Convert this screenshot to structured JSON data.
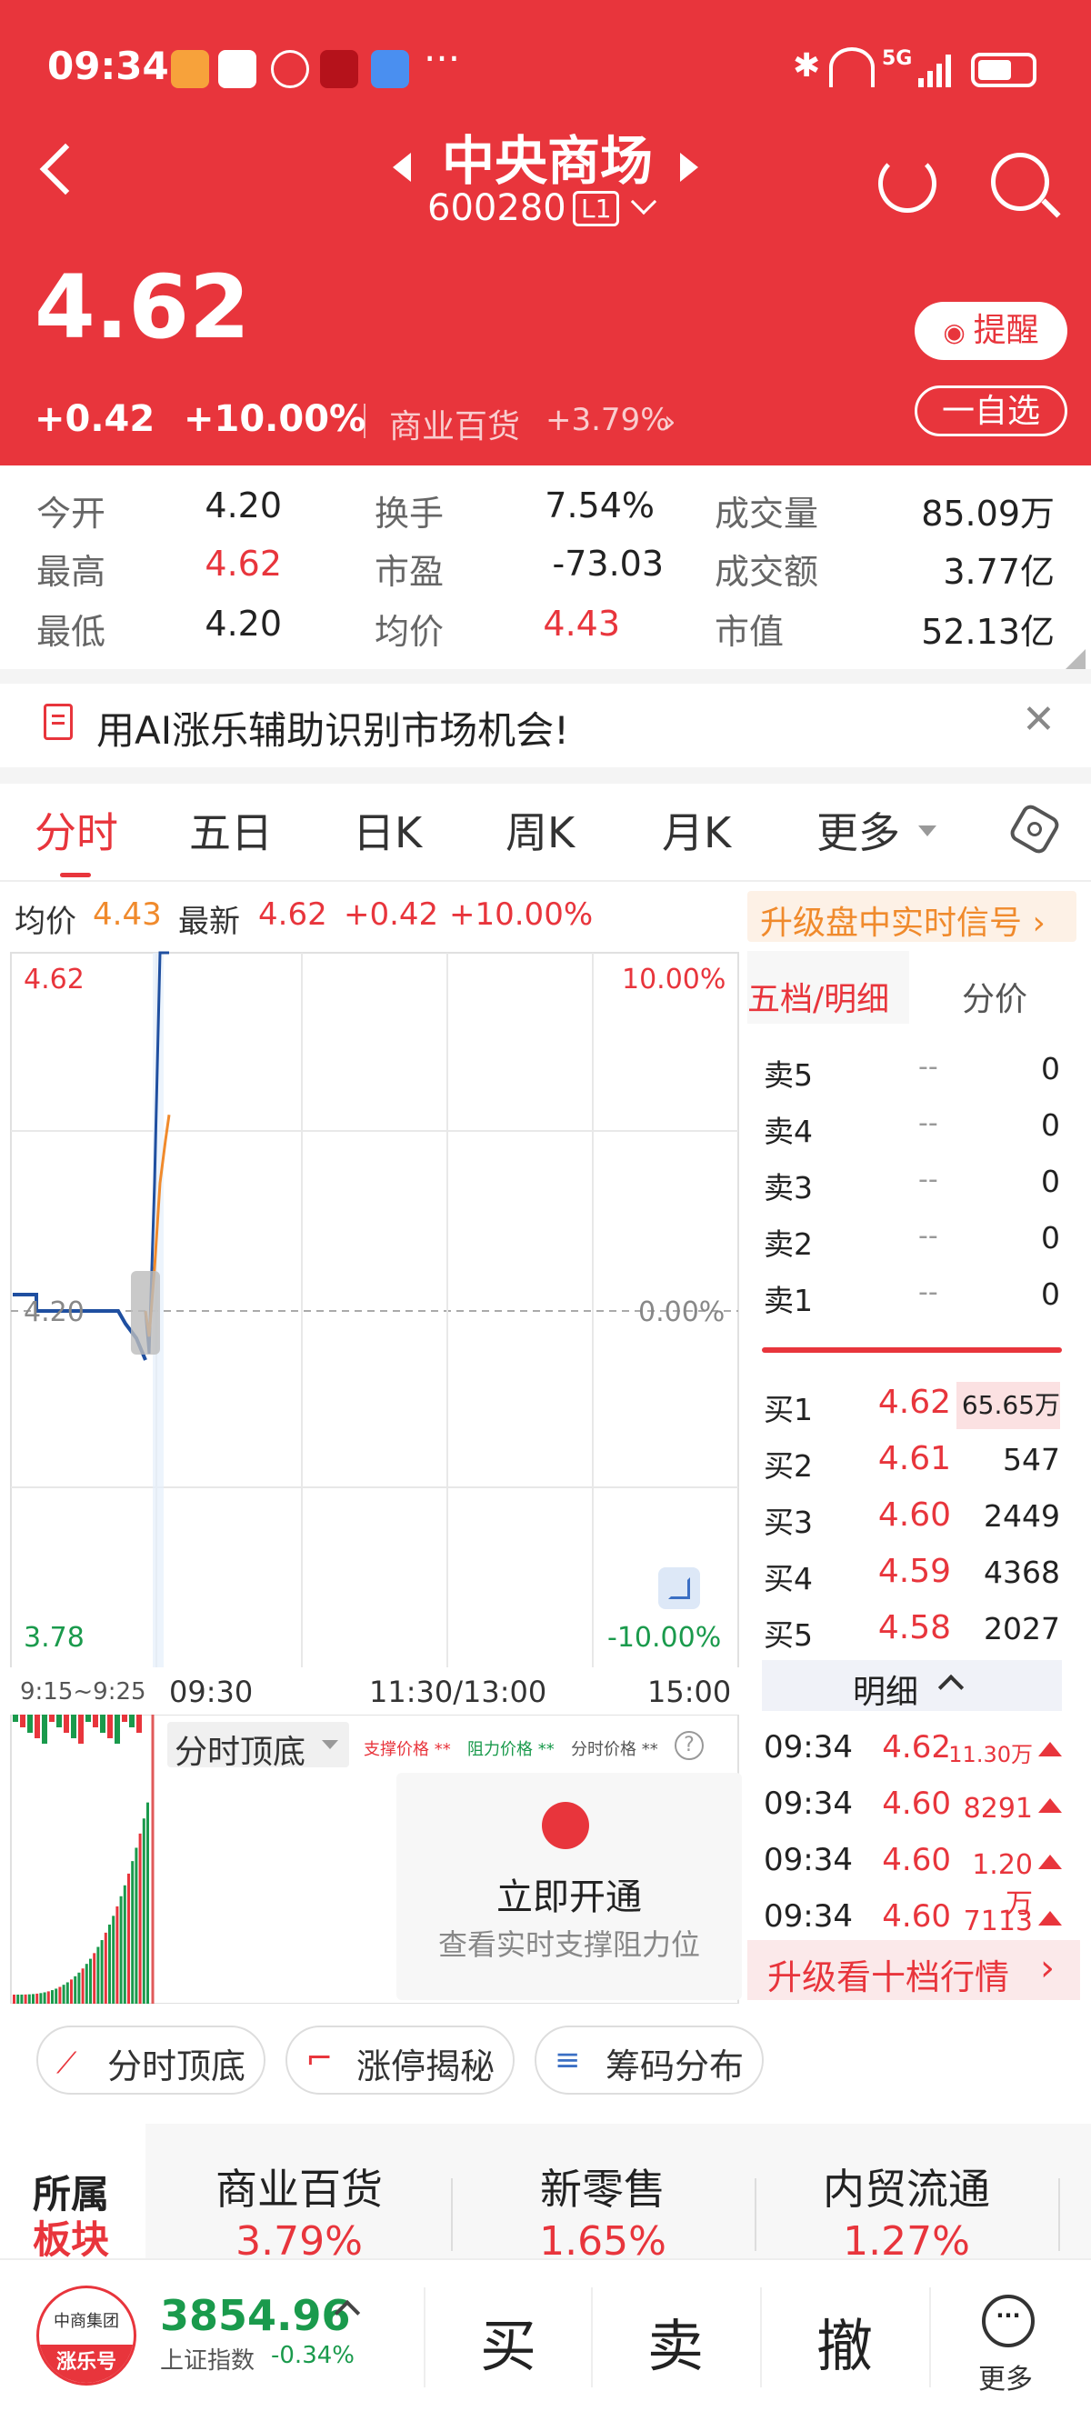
{
  "status_bar": {
    "time": "09:34",
    "more": "···",
    "net": "5G"
  },
  "nav": {
    "stock_name": "中央商场",
    "stock_code": "600280",
    "level": "L1"
  },
  "quote": {
    "price": "4.62",
    "change": "+0.42",
    "change_pct": "+10.00%",
    "sector_name": "商业百货",
    "sector_change": "+3.79%",
    "remind_label": "提醒",
    "watchlist_label": "一自选"
  },
  "stats": {
    "open_label": "今开",
    "open": "4.20",
    "turnover_label": "换手",
    "turnover": "7.54%",
    "volume_label": "成交量",
    "volume": "85.09万",
    "high_label": "最高",
    "high": "4.62",
    "pe_label": "市盈",
    "pe": "-73.03",
    "amount_label": "成交额",
    "amount": "3.77亿",
    "low_label": "最低",
    "low": "4.20",
    "avg_label": "均价",
    "avg": "4.43",
    "mktcap_label": "市值",
    "mktcap": "52.13亿"
  },
  "banner": {
    "text": "用AI涨乐辅助识别市场机会!"
  },
  "tabs": [
    "分时",
    "五日",
    "日K",
    "周K",
    "月K",
    "更多"
  ],
  "chart_info": {
    "avg_label": "均价",
    "avg": "4.43",
    "latest_label": "最新",
    "latest": "4.62",
    "change": "+0.42",
    "change_pct": "+10.00%",
    "upgrade_link": "升级盘中实时信号 ›"
  },
  "chart_axes": {
    "y_top": "4.62",
    "y_mid": "4.20",
    "y_bottom": "3.78",
    "pct_top": "10.00%",
    "pct_mid": "0.00%",
    "pct_bottom": "-10.00%",
    "t_pre": "9:15~9:25",
    "t_open": "09:30",
    "t_noon": "11:30/13:00",
    "t_close": "15:00"
  },
  "chart_data": {
    "type": "line",
    "title": "",
    "x": [
      "09:25",
      "09:30",
      "09:31",
      "09:32",
      "09:33",
      "09:34"
    ],
    "series": [
      {
        "values": [
          4.2,
          4.15,
          4.35,
          4.62,
          4.62,
          4.62
        ]
      },
      {
        "values": [
          4.2,
          4.17,
          4.25,
          4.35,
          4.4,
          4.43
        ]
      }
    ],
    "ylim": [
      3.78,
      4.62
    ],
    "y_pct_range": [
      "-10.00%",
      "10.00%"
    ],
    "pre_market_value": 4.2,
    "line_colors": [
      "#1f4fa0",
      "#f08a2c"
    ]
  },
  "order_book": {
    "title": "五档/明细",
    "tab2": "分价",
    "asks": [
      {
        "label": "卖5",
        "price": "--",
        "vol": "0"
      },
      {
        "label": "卖4",
        "price": "--",
        "vol": "0"
      },
      {
        "label": "卖3",
        "price": "--",
        "vol": "0"
      },
      {
        "label": "卖2",
        "price": "--",
        "vol": "0"
      },
      {
        "label": "卖1",
        "price": "--",
        "vol": "0"
      }
    ],
    "bids": [
      {
        "label": "买1",
        "price": "4.62",
        "vol": "65.65万"
      },
      {
        "label": "买2",
        "price": "4.61",
        "vol": "547"
      },
      {
        "label": "买3",
        "price": "4.60",
        "vol": "2449"
      },
      {
        "label": "买4",
        "price": "4.59",
        "vol": "4368"
      },
      {
        "label": "买5",
        "price": "4.58",
        "vol": "2027"
      }
    ],
    "detail_label": "明细",
    "ticks": [
      {
        "time": "09:34",
        "price": "4.62",
        "vol": "11.30万"
      },
      {
        "time": "09:34",
        "price": "4.60",
        "vol": "8291"
      },
      {
        "time": "09:34",
        "price": "4.60",
        "vol": "1.20万"
      },
      {
        "time": "09:34",
        "price": "4.60",
        "vol": "7113"
      }
    ],
    "upgrade": "升级看十档行情"
  },
  "indicator": {
    "name": "分时顶底",
    "support": "支撑价格 **",
    "resist": "阻力价格 **",
    "price": "分时价格 **",
    "promo_title": "立即开通",
    "promo_sub": "查看实时支撑阻力位"
  },
  "chips": [
    "分时顶底",
    "涨停揭秘",
    "筹码分布"
  ],
  "sectors": {
    "title_a": "所属",
    "title_b": "板块",
    "items": [
      {
        "name": "商业百货",
        "pct": "3.79%"
      },
      {
        "name": "新零售",
        "pct": "1.65%"
      },
      {
        "name": "内贸流通",
        "pct": "1.27%"
      }
    ]
  },
  "bottom": {
    "logo_top": "中商集团",
    "logo_brand": "涨乐号",
    "index_value": "3854.96",
    "index_name": "上证指数",
    "index_change": "-0.34%",
    "buy": "买",
    "sell": "卖",
    "cancel": "撤",
    "more": "更多"
  }
}
